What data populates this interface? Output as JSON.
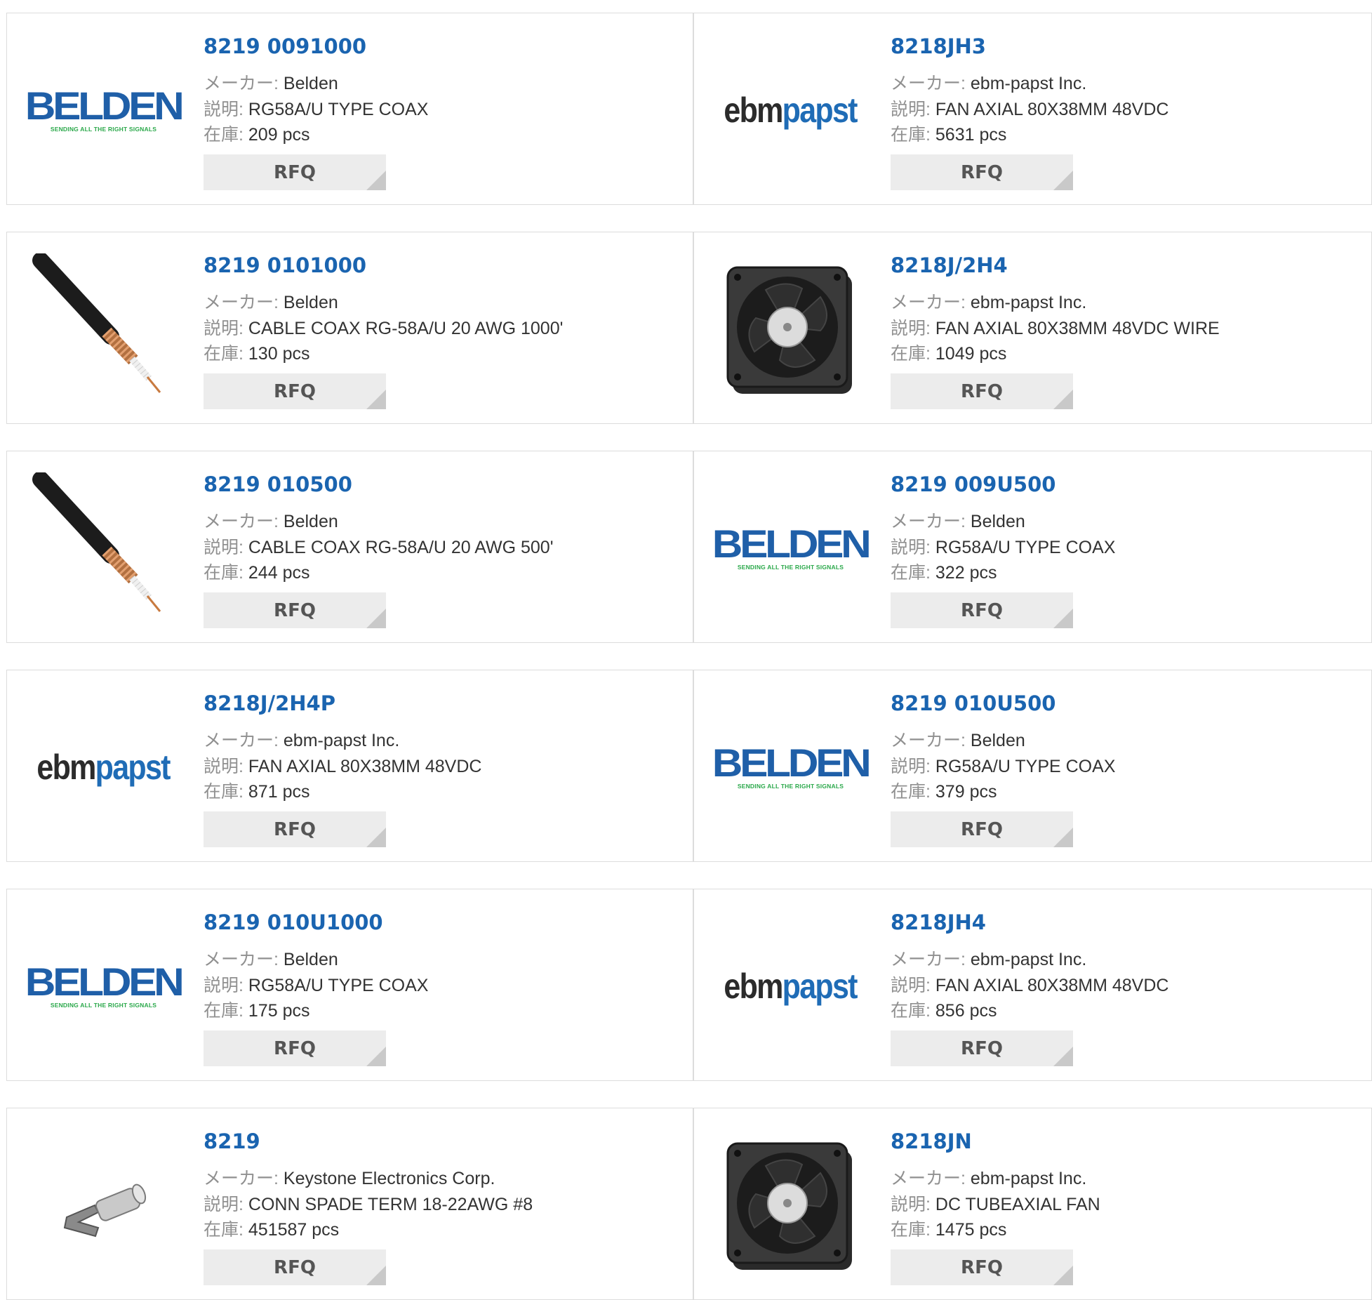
{
  "labels": {
    "manufacturer": "メーカー:",
    "description": "説明:",
    "stock": "在庫:",
    "rfq": "RFQ"
  },
  "logos": {
    "belden": {
      "word": "BELDEN",
      "tagline": "SENDING ALL THE RIGHT SIGNALS"
    },
    "ebmpapst": {
      "ebm": "ebm",
      "papst": "papst"
    }
  },
  "colors": {
    "part_number": "#1a64b0",
    "belden_blue": "#1f5fa8",
    "belden_green": "#2aa84a",
    "ebm_blue": "#1f6cb6",
    "rfq_bg": "#ececec",
    "border": "#dcdcdc"
  },
  "products": [
    {
      "part_number": "8219 0091000",
      "manufacturer": "Belden",
      "description": "RG58A/U TYPE COAX",
      "stock": "209 pcs",
      "image": "belden-logo"
    },
    {
      "part_number": "8218JH3",
      "manufacturer": "ebm-papst Inc.",
      "description": "FAN AXIAL 80X38MM 48VDC",
      "stock": "5631 pcs",
      "image": "ebmpapst-logo"
    },
    {
      "part_number": "8219 0101000",
      "manufacturer": "Belden",
      "description": "CABLE COAX RG-58A/U 20 AWG 1000'",
      "stock": "130 pcs",
      "image": "coax-cable-icon"
    },
    {
      "part_number": "8218J/2H4",
      "manufacturer": "ebm-papst Inc.",
      "description": "FAN AXIAL 80X38MM 48VDC WIRE",
      "stock": "1049 pcs",
      "image": "axial-fan-icon"
    },
    {
      "part_number": "8219 010500",
      "manufacturer": "Belden",
      "description": "CABLE COAX RG-58A/U 20 AWG 500'",
      "stock": "244 pcs",
      "image": "coax-cable-icon"
    },
    {
      "part_number": "8219 009U500",
      "manufacturer": "Belden",
      "description": "RG58A/U TYPE COAX",
      "stock": "322 pcs",
      "image": "belden-logo"
    },
    {
      "part_number": "8218J/2H4P",
      "manufacturer": "ebm-papst Inc.",
      "description": "FAN AXIAL 80X38MM 48VDC",
      "stock": "871 pcs",
      "image": "ebmpapst-logo"
    },
    {
      "part_number": "8219 010U500",
      "manufacturer": "Belden",
      "description": "RG58A/U TYPE COAX",
      "stock": "379 pcs",
      "image": "belden-logo"
    },
    {
      "part_number": "8219 010U1000",
      "manufacturer": "Belden",
      "description": "RG58A/U TYPE COAX",
      "stock": "175 pcs",
      "image": "belden-logo"
    },
    {
      "part_number": "8218JH4",
      "manufacturer": "ebm-papst Inc.",
      "description": "FAN AXIAL 80X38MM 48VDC",
      "stock": "856 pcs",
      "image": "ebmpapst-logo"
    },
    {
      "part_number": "8219",
      "manufacturer": "Keystone Electronics Corp.",
      "description": "CONN SPADE TERM 18-22AWG #8",
      "stock": "451587 pcs",
      "image": "spade-terminal-icon"
    },
    {
      "part_number": "8218JN",
      "manufacturer": "ebm-papst Inc.",
      "description": "DC TUBEAXIAL FAN",
      "stock": "1475 pcs",
      "image": "axial-fan-icon"
    }
  ]
}
